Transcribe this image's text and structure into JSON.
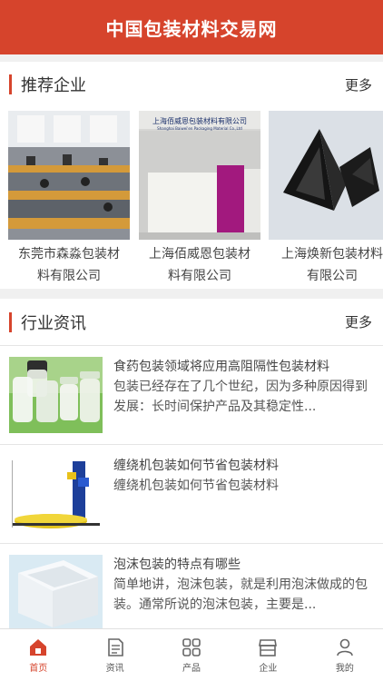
{
  "header": {
    "title": "中国包装材料交易网"
  },
  "recommended": {
    "title": "推荐企业",
    "more": "更多",
    "companies": [
      {
        "name_line1": "东莞市森淼包装材",
        "name_line2": "料有限公司",
        "image": "office-photo"
      },
      {
        "name_line1": "上海佰威恩包装材",
        "name_line2": "料有限公司",
        "image": "reception-desk-photo",
        "sign_text": "上海佰威恩包装材料有限公司",
        "sign_sub": "Shanghai Baiwei'en Packaging Material Co.,Ltd"
      },
      {
        "name_line1": "上海焕新包装材料",
        "name_line2": "有限公司",
        "image": "black-corner-protector-photo"
      }
    ]
  },
  "news": {
    "title": "行业资讯",
    "more": "更多",
    "items": [
      {
        "title": "食药包装领域将应用高阻隔性包装材料",
        "desc": "包装已经存在了几个世纪，因为多种原因得到发展：长时间保护产品及其稳定性...",
        "image": "plastic-jars-photo"
      },
      {
        "title": "缠绕机包装如何节省包装材料",
        "desc": "缠绕机包装如何节省包装材料",
        "image": "wrapping-machine-photo"
      },
      {
        "title": "泡沫包装的特点有哪些",
        "desc": "简单地讲，泡沫包装，就是利用泡沫做成的包装。通常所说的泡沫包装，主要是...",
        "image": "foam-box-photo"
      }
    ]
  },
  "tabbar": {
    "items": [
      {
        "label": "首页",
        "icon": "home-icon",
        "active": true
      },
      {
        "label": "资讯",
        "icon": "document-icon",
        "active": false
      },
      {
        "label": "产品",
        "icon": "grid-icon",
        "active": false
      },
      {
        "label": "企业",
        "icon": "store-icon",
        "active": false
      },
      {
        "label": "我的",
        "icon": "user-icon",
        "active": false
      }
    ]
  },
  "colors": {
    "brand": "#d6442c",
    "active_tab": "#d6442c"
  }
}
